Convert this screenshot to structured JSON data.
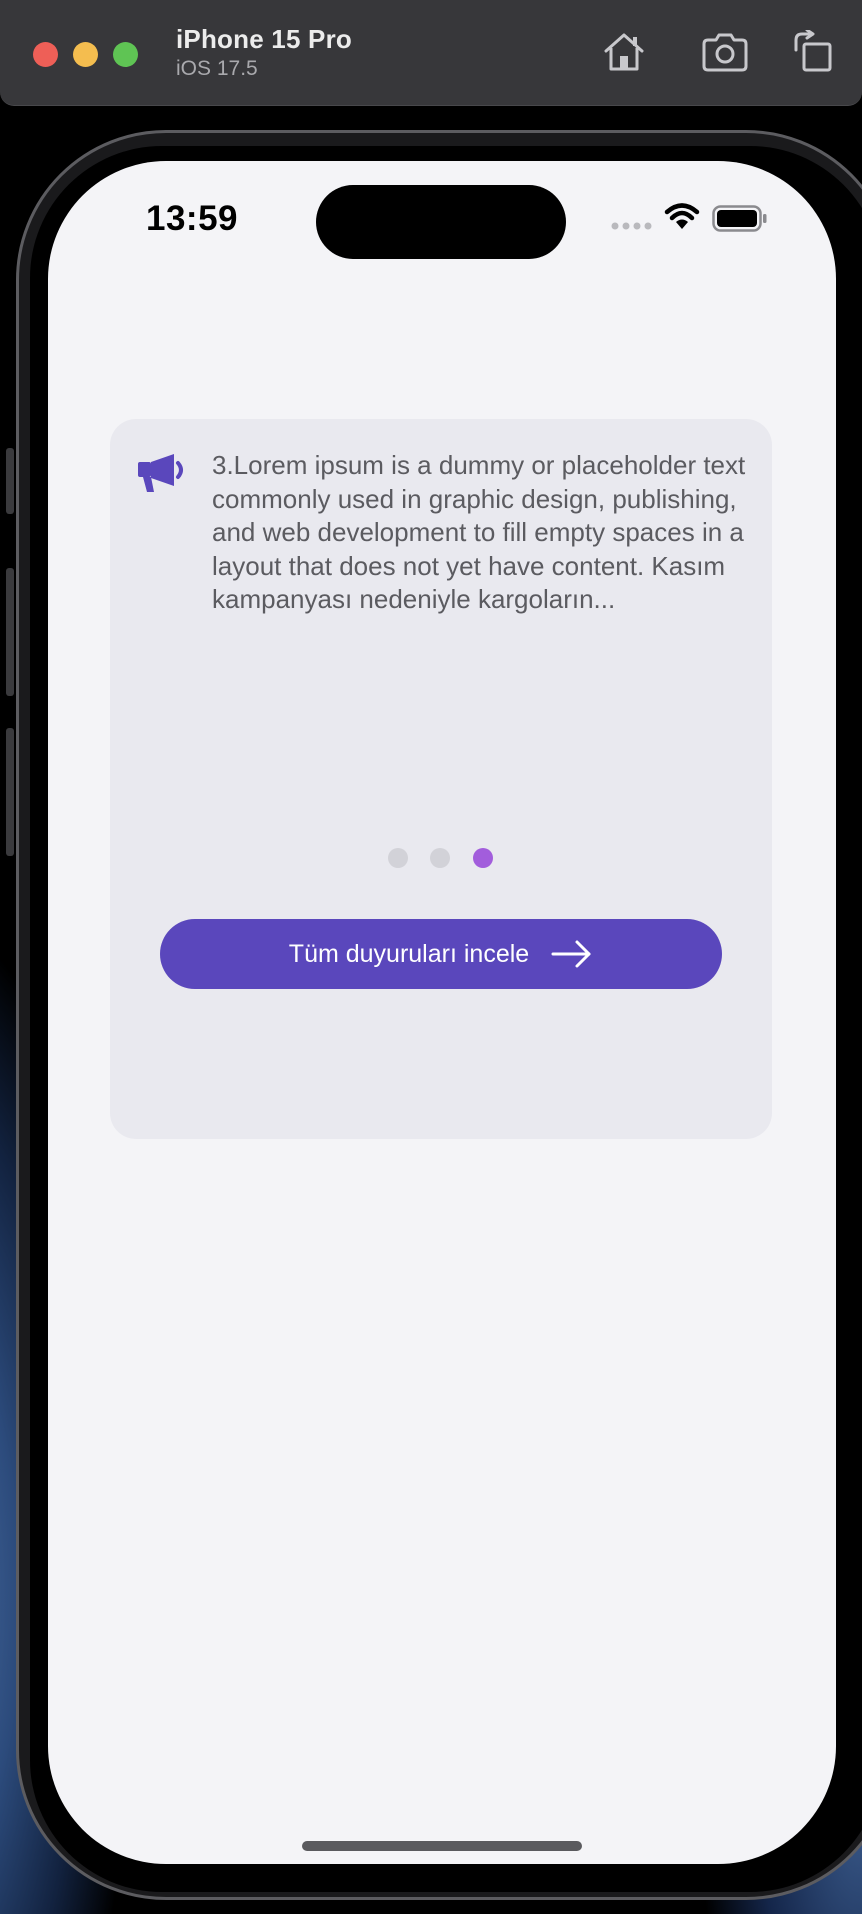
{
  "simulator": {
    "device_name": "iPhone 15 Pro",
    "os_version": "iOS 17.5",
    "toolbar_icons": [
      "home-icon",
      "screenshot-icon",
      "rotate-icon"
    ]
  },
  "status_bar": {
    "time": "13:59",
    "icons": [
      "signal-dots-icon",
      "wifi-icon",
      "battery-icon"
    ]
  },
  "announcement_card": {
    "icon": "megaphone-icon",
    "text": "3.Lorem ipsum is a dummy or placeholder text commonly used in graphic design, publishing, and web development to fill empty spaces in a layout that does not yet have content. Kasım kampanyası nedeniyle kargoların...",
    "pager": {
      "count": 3,
      "active_index": 2
    },
    "button_label": "Tüm duyuruları incele",
    "button_icon": "arrow-right-icon"
  },
  "colors": {
    "accent": "#5a47bc",
    "active_dot": "#a25ddc",
    "inactive_dot": "#d2d2d8",
    "card_bg": "#e9e9ef",
    "screen_bg": "#f4f4f7"
  }
}
